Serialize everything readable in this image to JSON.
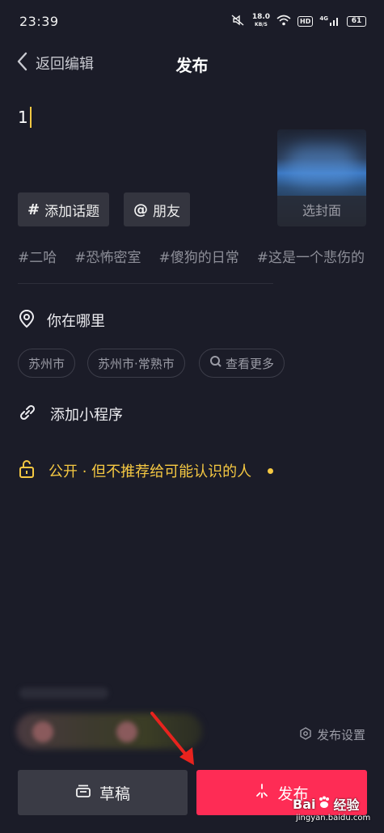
{
  "status_bar": {
    "time": "23:39",
    "speed_value": "18.0",
    "speed_unit": "KB/S",
    "hd": "HD",
    "network": "4G",
    "battery": "61"
  },
  "header": {
    "back_label": "返回编辑",
    "title": "发布"
  },
  "caption": {
    "value": "1"
  },
  "cover": {
    "label": "选封面"
  },
  "chips": {
    "topic_icon": "#",
    "topic_label": "添加话题",
    "friend_icon": "@",
    "friend_label": "朋友"
  },
  "hashtags": [
    "#二哈",
    "#恐怖密室",
    "#傻狗的日常",
    "#这是一个悲伤的"
  ],
  "location": {
    "label": "你在哪里",
    "options": [
      "苏州市",
      "苏州市·常熟市",
      "查看更多"
    ]
  },
  "mini_program": {
    "label": "添加小程序"
  },
  "privacy": {
    "label": "公开 · 但不推荐给可能认识的人"
  },
  "settings": {
    "label": "发布设置"
  },
  "buttons": {
    "draft_label": "草稿",
    "publish_label": "发布"
  },
  "watermark": {
    "main": "Bai",
    "main2": "经验",
    "sub": "jingyan.baidu.com"
  },
  "colors": {
    "background": "#1b1c28",
    "accent_yellow": "#f5c842",
    "publish_red": "#fe2c55",
    "chip_bg": "#34353f"
  },
  "icons": {
    "back": "chevron-left-icon",
    "location": "location-pin-icon",
    "mini_program": "link-icon",
    "privacy": "unlock-icon",
    "settings": "gear-icon",
    "draft": "draft-box-icon",
    "publish": "sparkle-icon",
    "search": "search-icon"
  }
}
